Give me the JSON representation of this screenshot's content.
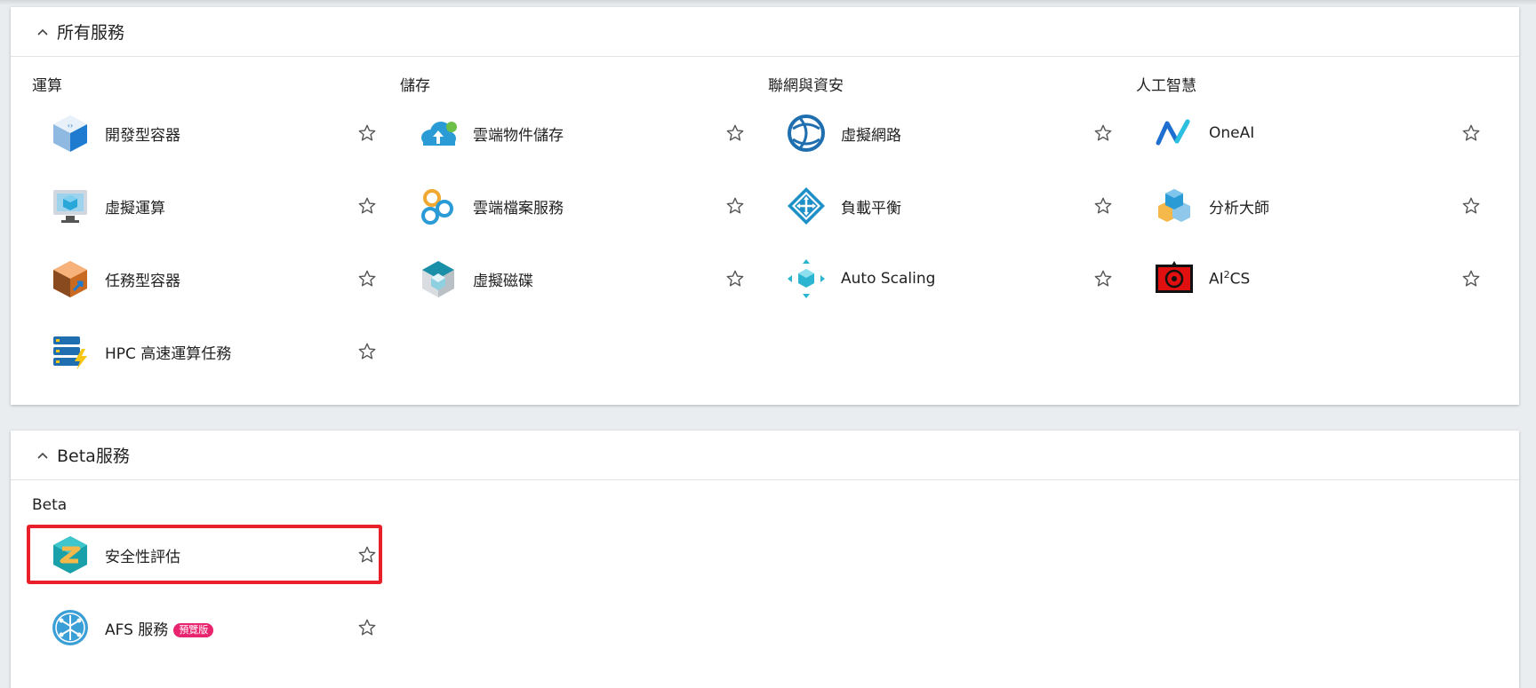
{
  "all_services": {
    "title": "所有服務",
    "categories": [
      {
        "title": "運算",
        "items": [
          {
            "label": "開發型容器",
            "icon": "dev-container-icon"
          },
          {
            "label": "虛擬運算",
            "icon": "virtual-compute-icon"
          },
          {
            "label": "任務型容器",
            "icon": "job-container-icon"
          },
          {
            "label": "HPC 高速運算任務",
            "icon": "hpc-icon"
          }
        ]
      },
      {
        "title": "儲存",
        "items": [
          {
            "label": "雲端物件儲存",
            "icon": "cloud-object-storage-icon"
          },
          {
            "label": "雲端檔案服務",
            "icon": "cloud-file-service-icon"
          },
          {
            "label": "虛擬磁碟",
            "icon": "virtual-disk-icon"
          }
        ]
      },
      {
        "title": "聯網與資安",
        "items": [
          {
            "label": "虛擬網路",
            "icon": "virtual-network-icon"
          },
          {
            "label": "負載平衡",
            "icon": "load-balancer-icon"
          },
          {
            "label": "Auto Scaling",
            "icon": "auto-scaling-icon"
          }
        ]
      },
      {
        "title": "人工智慧",
        "items": [
          {
            "label": "OneAI",
            "icon": "oneai-icon"
          },
          {
            "label": "分析大師",
            "icon": "analytics-master-icon"
          },
          {
            "label_prefix": "AI",
            "label_sup": "2",
            "label_suffix": "CS",
            "icon": "ai2cs-icon"
          }
        ]
      }
    ]
  },
  "beta_services": {
    "title": "Beta服務",
    "categories": [
      {
        "title": "Beta",
        "items": [
          {
            "label": "安全性評估",
            "icon": "security-assessment-icon"
          },
          {
            "label": "AFS 服務",
            "badge": "預覽版",
            "icon": "afs-icon"
          }
        ]
      }
    ]
  },
  "colors": {
    "accent_red": "#e8202a",
    "badge_pink": "#e8246e",
    "background": "#eaedf0"
  },
  "icons": {
    "collapse": "chevron-up-icon",
    "favorite": "star-outline-icon"
  }
}
